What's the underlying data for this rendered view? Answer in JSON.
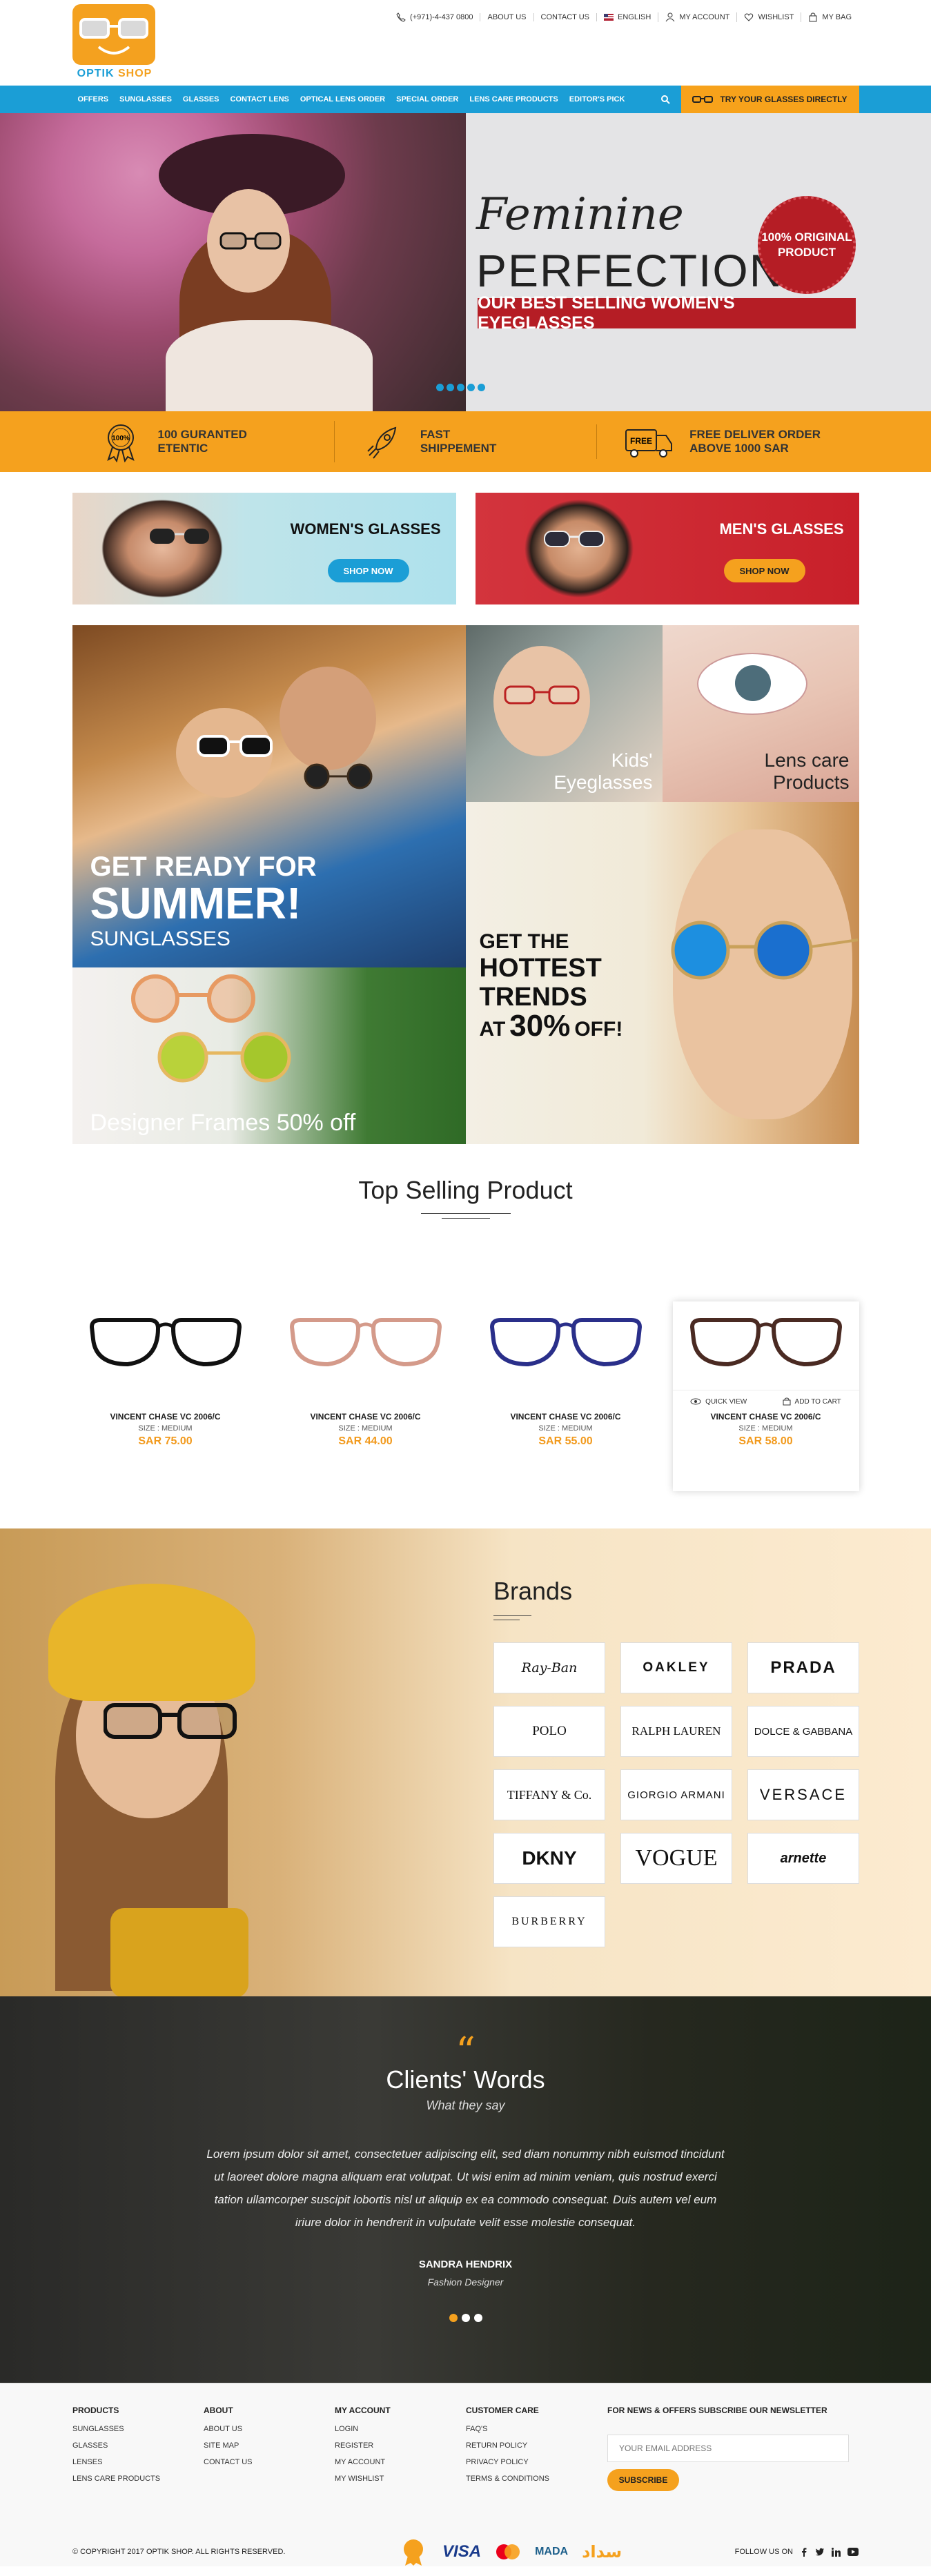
{
  "topbar": {
    "phone": "(+971)-4-437 0800",
    "about": "ABOUT US",
    "contact": "CONTACT US",
    "language": "ENGLISH",
    "account": "MY ACCOUNT",
    "wishlist": "WISHLIST",
    "bag": "MY BAG"
  },
  "logo": {
    "part1": "OPTIK",
    "part2": "SHOP"
  },
  "nav": {
    "items": [
      "OFFERS",
      "SUNGLASSES",
      "GLASSES",
      "CONTACT LENS",
      "OPTICAL LENS ORDER",
      "SPECIAL ORDER",
      "LENS CARE PRODUCTS",
      "EDITOR'S PICK"
    ],
    "try": "TRY YOUR GLASSES DIRECTLY"
  },
  "hero": {
    "line1": "Feminine",
    "line2": "PERFECTION",
    "banner": "OUR BEST SELLING WOMEN'S EYEGLASSES",
    "badge": "100% ORIGINAL PRODUCT"
  },
  "features": [
    {
      "text": "100 GURANTED\nETENTIC",
      "icon": "badge-100-icon"
    },
    {
      "text": "FAST\nSHIPPEMENT",
      "icon": "rocket-icon"
    },
    {
      "text": "FREE DELIVER ORDER\nABOVE 1000 SAR",
      "icon": "truck-icon"
    }
  ],
  "cats": {
    "women": "WOMEN'S GLASSES",
    "men": "MEN'S GLASSES",
    "shop": "SHOP NOW"
  },
  "collage": {
    "summer1": "GET READY FOR",
    "summer2": "SUMMER!",
    "summer3": "SUNGLASSES",
    "kids1": "Kids'",
    "kids2": "Eyeglasses",
    "lens1": "Lens care",
    "lens2": "Products",
    "trend1": "GET THE",
    "trend2": "HOTTEST",
    "trend3": "TRENDS",
    "trend4": "AT",
    "trend5": "30%",
    "trend6": "OFF!",
    "designer": "Designer Frames 50% off"
  },
  "top_selling": {
    "title": "Top Selling Product",
    "quick": "QUICK VIEW",
    "add": "ADD TO CART",
    "products": [
      {
        "name": "VINCENT CHASE VC 2006/C",
        "size": "SIZE : MEDIUM",
        "price": "SAR 75.00",
        "color": "#111111"
      },
      {
        "name": "VINCENT CHASE VC 2006/C",
        "size": "SIZE : MEDIUM",
        "price": "SAR 44.00",
        "color": "#d49a8a"
      },
      {
        "name": "VINCENT CHASE VC 2006/C",
        "size": "SIZE : MEDIUM",
        "price": "SAR 55.00",
        "color": "#2a2f8a"
      },
      {
        "name": "VINCENT CHASE VC 2006/C",
        "size": "SIZE : MEDIUM",
        "price": "SAR 58.00",
        "color": "#4a2a22"
      }
    ]
  },
  "brands": {
    "title": "Brands",
    "list": [
      "Ray-Ban",
      "OAKLEY",
      "PRADA",
      "POLO",
      "RALPH LAUREN",
      "DOLCE & GABBANA",
      "TIFFANY & Co.",
      "GIORGIO ARMANI",
      "VERSACE",
      "DKNY",
      "VOGUE",
      "arnette",
      "BURBERRY"
    ]
  },
  "testimonial": {
    "title": "Clients' Words",
    "subtitle": "What they say",
    "body": "Lorem ipsum dolor sit amet, consectetuer adipiscing elit, sed diam nonummy nibh euismod tincidunt ut laoreet dolore magna aliquam erat volutpat. Ut wisi enim ad minim veniam, quis nostrud exerci tation ullamcorper suscipit lobortis nisl ut aliquip ex ea commodo consequat. Duis autem vel eum iriure dolor in hendrerit in vulputate velit esse molestie consequat.",
    "name": "SANDRA HENDRIX",
    "role": "Fashion Designer"
  },
  "footer": {
    "products": {
      "title": "PRODUCTS",
      "links": [
        "SUNGLASSES",
        "GLASSES",
        "LENSES",
        "LENS CARE PRODUCTS"
      ]
    },
    "about": {
      "title": "ABOUT",
      "links": [
        "ABOUT US",
        "SITE MAP",
        "CONTACT US"
      ]
    },
    "account": {
      "title": "MY ACCOUNT",
      "links": [
        "LOGIN",
        "REGISTER",
        "MY ACCOUNT",
        "MY WISHLIST"
      ]
    },
    "care": {
      "title": "CUSTOMER CARE",
      "links": [
        "FAQ'S",
        "RETURN POLICY",
        "PRIVACY POLICY",
        "TERMS & CONDITIONS"
      ]
    },
    "newsletter": {
      "title": "FOR NEWS & OFFERS SUBSCRIBE OUR NEWSLETTER",
      "placeholder": "YOUR EMAIL ADDRESS",
      "button": "SUBSCRIBE"
    },
    "copyright": "© COPYRIGHT 2017 OPTIK SHOP. ALL RIGHTS RESERVED.",
    "payments": {
      "visa": "VISA",
      "mada": "mada",
      "sadad": "سداد"
    },
    "follow": "FOLLOW US ON"
  }
}
